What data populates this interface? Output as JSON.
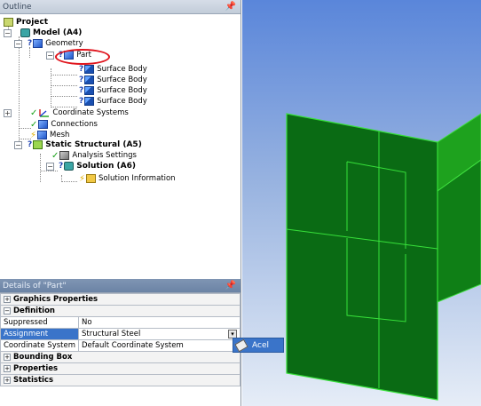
{
  "outline": {
    "title": "Outline",
    "pin": "p"
  },
  "tree": {
    "project": "Project",
    "model": "Model (A4)",
    "geometry": "Geometry",
    "part": "Part",
    "surface_bodies": [
      "Surface Body",
      "Surface Body",
      "Surface Body",
      "Surface Body"
    ],
    "coord": "Coordinate Systems",
    "connections": "Connections",
    "mesh": "Mesh",
    "static": "Static Structural (A5)",
    "analysis_settings": "Analysis Settings",
    "solution": "Solution (A6)",
    "solution_info": "Solution Information"
  },
  "details": {
    "title": "Details of \"Part\"",
    "groups": {
      "graphics": "Graphics Properties",
      "definition": "Definition",
      "bounding": "Bounding Box",
      "properties": "Properties",
      "statistics": "Statistics"
    },
    "rows": {
      "suppressed_label": "Suppressed",
      "suppressed_value": "No",
      "assignment_label": "Assignment",
      "assignment_value": "Structural Steel",
      "coord_label": "Coordinate System",
      "coord_value": "Default Coordinate System"
    }
  },
  "popup": {
    "item": "Acel"
  },
  "colors": {
    "highlight_ring": "#e0141c",
    "selection": "#3a74c9",
    "part_green": "#0a6b14",
    "edge_green": "#37e03a"
  }
}
